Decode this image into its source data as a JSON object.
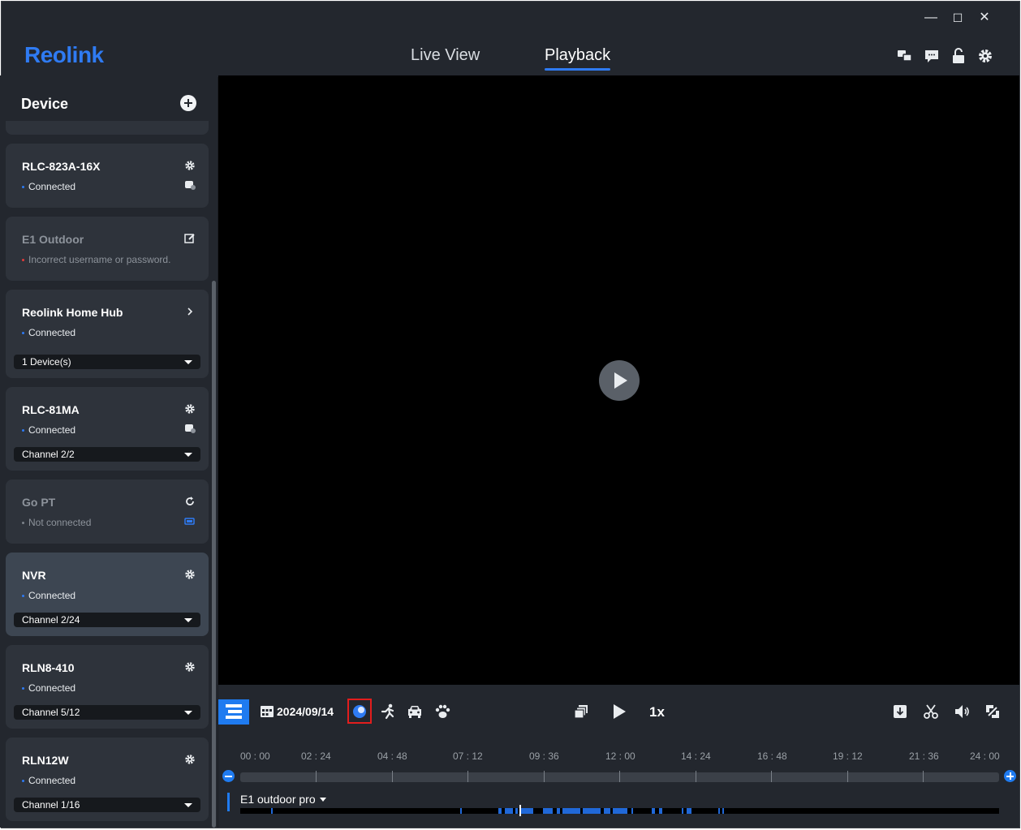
{
  "app": {
    "brand": "Reolink"
  },
  "window_controls": {
    "minimize": "—",
    "maximize": "☐",
    "close": "✕"
  },
  "nav": {
    "live_view": "Live View",
    "playback": "Playback"
  },
  "sidebar": {
    "title": "Device",
    "devices": [
      {
        "name": "RLC-823A-16X",
        "status": "Connected"
      },
      {
        "name": "E1 Outdoor",
        "status": "Incorrect username or password."
      },
      {
        "name": "Reolink Home Hub",
        "status": "Connected",
        "select": "1 Device(s)"
      },
      {
        "name": "RLC-81MA",
        "status": "Connected",
        "select": "Channel 2/2"
      },
      {
        "name": "Go PT",
        "status": "Not connected"
      },
      {
        "name": "NVR",
        "status": "Connected",
        "select": "Channel 2/24"
      },
      {
        "name": "RLN8-410",
        "status": "Connected",
        "select": "Channel 5/12"
      },
      {
        "name": "RLN12W",
        "status": "Connected",
        "select": "Channel 1/16"
      }
    ]
  },
  "playback": {
    "date": "2024/09/14",
    "speed": "1x",
    "timeline_hours": [
      "00 : 00",
      "02 : 24",
      "04 : 48",
      "07 : 12",
      "09 : 36",
      "12 : 00",
      "14 : 24",
      "16 : 48",
      "19 : 12",
      "21 : 36",
      "24 : 00"
    ],
    "channel": "E1 outdoor pro"
  },
  "colors": {
    "accent": "#1f7bf0",
    "background": "#1b1e23",
    "panel": "#23272e",
    "card": "#2e333b",
    "error": "#e23b3b",
    "highlight_box": "#e21d1d"
  },
  "icons": [
    "minimize-icon",
    "maximize-icon",
    "close-icon",
    "translate-icon",
    "message-icon",
    "unlock-icon",
    "settings-icon",
    "add-device-icon",
    "gear-icon",
    "battery-camera-icon",
    "edit-icon",
    "chevron-right-icon",
    "refresh-icon",
    "battery-icon",
    "timeline-icon",
    "calendar-icon",
    "ai-filter-icon",
    "person-icon",
    "vehicle-icon",
    "pet-icon",
    "multi-window-icon",
    "play-icon",
    "download-icon",
    "scissors-icon",
    "volume-icon",
    "fullscreen-icon"
  ]
}
